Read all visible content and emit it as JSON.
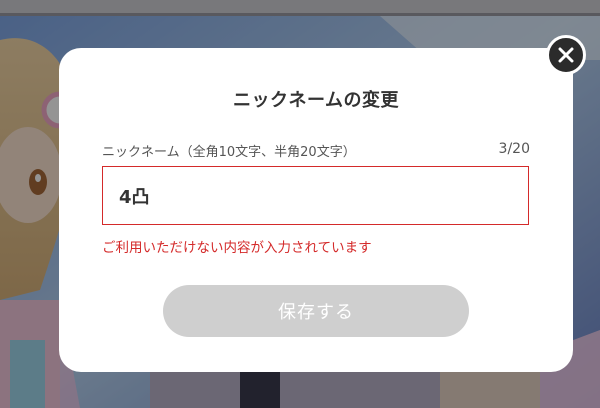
{
  "dialog": {
    "title": "ニックネームの変更",
    "field_label": "ニックネーム（全角10文字、半角20文字）",
    "char_count": "3/20",
    "nickname_value": "4凸",
    "error_message": "ご利用いただけない内容が入力されています",
    "save_label": "保存する"
  },
  "icons": {
    "close": "close-icon"
  },
  "colors": {
    "error": "#d42a2a",
    "button_disabled": "#cfcfcf",
    "close_button_bg": "#2b2b2b",
    "overlay": "rgba(0,0,0,0.42)"
  }
}
